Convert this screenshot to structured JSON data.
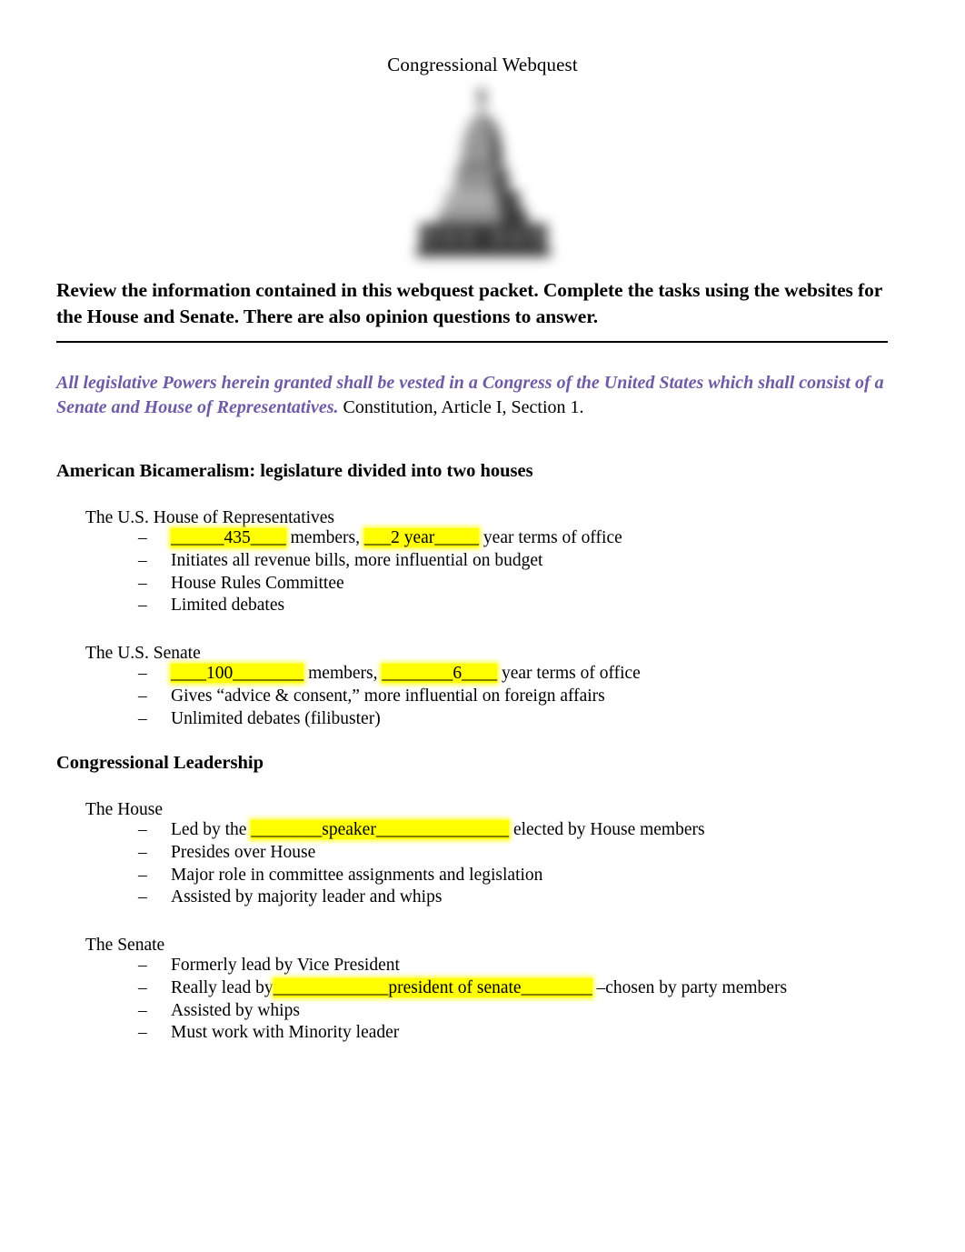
{
  "document": {
    "title": "Congressional Webquest",
    "hero_image_alt": "capitol-building-photo",
    "intro": "Review the information contained in this webquest packet.  Complete the tasks using the websites for the House and Senate.  There are also opinion questions to answer.",
    "quote": {
      "text": "All legislative Powers herein granted shall be vested in a Congress of the United States which shall consist of a Senate and House of Representatives.",
      "citation": " Constitution, Article I, Section 1.",
      "color": "#6D5BA6"
    },
    "highlight_color": "#FFFF00",
    "sections": [
      {
        "heading": "American Bicameralism: legislature divided into two houses",
        "groups": [
          {
            "subheading": "The U.S. House of Representatives",
            "bullets": [
              {
                "dash": "–",
                "parts": [
                  {
                    "text": "______435____",
                    "highlight": true
                  },
                  {
                    "text": " members, ",
                    "highlight": false
                  },
                  {
                    "text": "___2 year_____",
                    "highlight": true
                  },
                  {
                    "text": " year terms of office",
                    "highlight": false
                  }
                ]
              },
              {
                "dash": "–",
                "parts": [
                  {
                    "text": "Initiates all revenue bills, more influential on budget",
                    "highlight": false
                  }
                ]
              },
              {
                "dash": "–",
                "parts": [
                  {
                    "text": "House Rules Committee",
                    "highlight": false
                  }
                ]
              },
              {
                "dash": "–",
                "parts": [
                  {
                    "text": "Limited debates",
                    "highlight": false
                  }
                ]
              }
            ]
          },
          {
            "subheading": "The U.S. Senate",
            "bullets": [
              {
                "dash": "–",
                "parts": [
                  {
                    "text": "____100________",
                    "highlight": true
                  },
                  {
                    "text": " members, ",
                    "highlight": false
                  },
                  {
                    "text": "________6____",
                    "highlight": true
                  },
                  {
                    "text": " year terms of office",
                    "highlight": false
                  }
                ]
              },
              {
                "dash": "–",
                "parts": [
                  {
                    "text": "Gives “advice & consent,” more influential on foreign affairs",
                    "highlight": false
                  }
                ]
              },
              {
                "dash": "–",
                "parts": [
                  {
                    "text": "Unlimited debates (filibuster)",
                    "highlight": false
                  }
                ]
              }
            ]
          }
        ]
      },
      {
        "heading": "Congressional Leadership",
        "groups": [
          {
            "subheading": "The House",
            "bullets": [
              {
                "dash": "–",
                "parts": [
                  {
                    "text": "Led by the ",
                    "highlight": false
                  },
                  {
                    "text": "________speaker_______________",
                    "highlight": true
                  },
                  {
                    "text": " elected by House members",
                    "highlight": false
                  }
                ]
              },
              {
                "dash": "–",
                "parts": [
                  {
                    "text": "Presides over House",
                    "highlight": false
                  }
                ]
              },
              {
                "dash": "–",
                "parts": [
                  {
                    "text": "Major role in committee assignments and legislation",
                    "highlight": false
                  }
                ]
              },
              {
                "dash": "–",
                "parts": [
                  {
                    "text": "Assisted by majority leader and whips",
                    "highlight": false
                  }
                ]
              }
            ]
          },
          {
            "subheading": "The Senate",
            "bullets": [
              {
                "dash": "–",
                "parts": [
                  {
                    "text": "Formerly lead by Vice President",
                    "highlight": false
                  }
                ]
              },
              {
                "dash": "–",
                "parts": [
                  {
                    "text": "Really lead by",
                    "highlight": false
                  },
                  {
                    "text": "_____________president of senate________",
                    "highlight": true
                  },
                  {
                    "text": " –chosen by party members",
                    "highlight": false
                  }
                ]
              },
              {
                "dash": "–",
                "parts": [
                  {
                    "text": "Assisted by whips",
                    "highlight": false
                  }
                ]
              },
              {
                "dash": "–",
                "parts": [
                  {
                    "text": "Must work with Minority leader",
                    "highlight": false
                  }
                ]
              }
            ]
          }
        ]
      }
    ]
  }
}
